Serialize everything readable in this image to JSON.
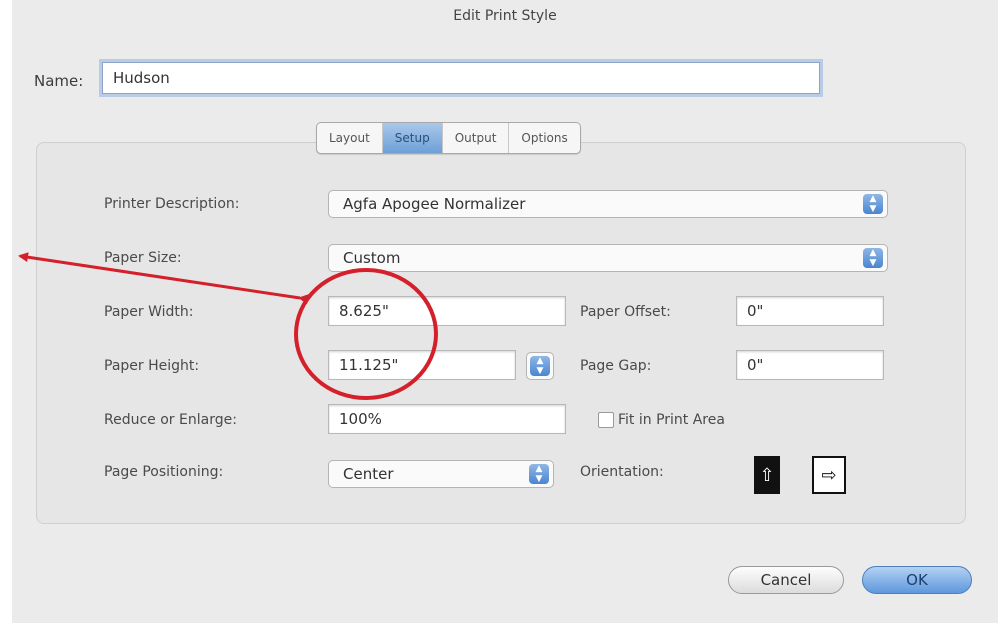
{
  "window": {
    "title": "Edit Print Style"
  },
  "name_field": {
    "label": "Name:",
    "value": "Hudson"
  },
  "tabs": [
    {
      "label": "Layout",
      "active": false
    },
    {
      "label": "Setup",
      "active": true
    },
    {
      "label": "Output",
      "active": false
    },
    {
      "label": "Options",
      "active": false
    }
  ],
  "setup": {
    "printer_description": {
      "label": "Printer Description:",
      "value": "Agfa Apogee Normalizer"
    },
    "paper_size": {
      "label": "Paper Size:",
      "value": "Custom"
    },
    "paper_width": {
      "label": "Paper Width:",
      "value": "8.625\""
    },
    "paper_height": {
      "label": "Paper Height:",
      "value": "11.125\""
    },
    "paper_offset": {
      "label": "Paper Offset:",
      "value": "0\""
    },
    "page_gap": {
      "label": "Page Gap:",
      "value": "0\""
    },
    "reduce_enlarge": {
      "label": "Reduce or Enlarge:",
      "value": "100%"
    },
    "fit_in_print_area": {
      "label": "Fit in Print Area",
      "checked": false
    },
    "page_positioning": {
      "label": "Page Positioning:",
      "value": "Center"
    },
    "orientation": {
      "label": "Orientation:",
      "selected": "portrait"
    }
  },
  "buttons": {
    "cancel": "Cancel",
    "ok": "OK"
  },
  "colors": {
    "annotation": "#d4202a",
    "accent": "#6e9fd6"
  }
}
